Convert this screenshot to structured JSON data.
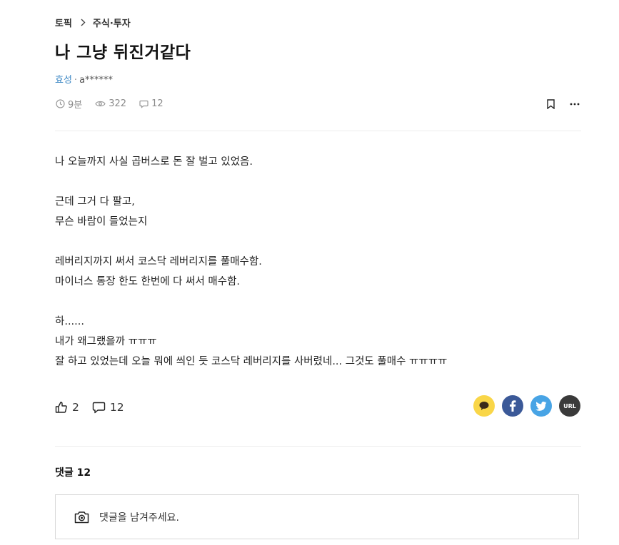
{
  "breadcrumb": {
    "root": "토픽",
    "current": "주식·투자"
  },
  "post": {
    "title": "나 그냥 뒤진거같다",
    "company": "효성",
    "author": "a******",
    "time": "9분",
    "views": "322",
    "comments": "12"
  },
  "body": [
    "나 오늘까지 사실 곱버스로 돈 잘 벌고 있었음.",
    "",
    "근데 그거 다 팔고,",
    "무슨 바람이 들었는지",
    "",
    "레버리지까지 써서 코스닥 레버리지를 풀매수함.",
    "마이너스 통장 한도 한번에 다 써서 매수함.",
    "",
    "하......",
    "내가 왜그랬을까 ㅠㅠㅠ",
    "잘 하고 있었는데 오늘 뭐에 씌인 듯 코스닥 레버리지를 사버렸네... 그것도 풀매수 ㅠㅠㅠㅠ"
  ],
  "reactions": {
    "likes": "2",
    "comments": "12"
  },
  "share": {
    "url_label": "URL"
  },
  "comments_section": {
    "label": "댓글 12",
    "placeholder": "댓글을 남겨주세요."
  },
  "icons": {
    "breadcrumb": "chevron-right-icon",
    "time": "clock-icon",
    "views": "eye-icon",
    "comments": "speech-bubble-icon",
    "bookmark": "bookmark-icon",
    "more": "more-horizontal-icon",
    "like": "thumbs-up-icon",
    "kakao": "kakaotalk-icon",
    "facebook": "facebook-icon",
    "twitter": "twitter-icon",
    "camera": "camera-icon"
  },
  "colors": {
    "company": "#3b87c4",
    "kakao": "#f9d648",
    "facebook": "#3b5998",
    "twitter": "#48a4e5",
    "url": "#3a3a3a"
  }
}
